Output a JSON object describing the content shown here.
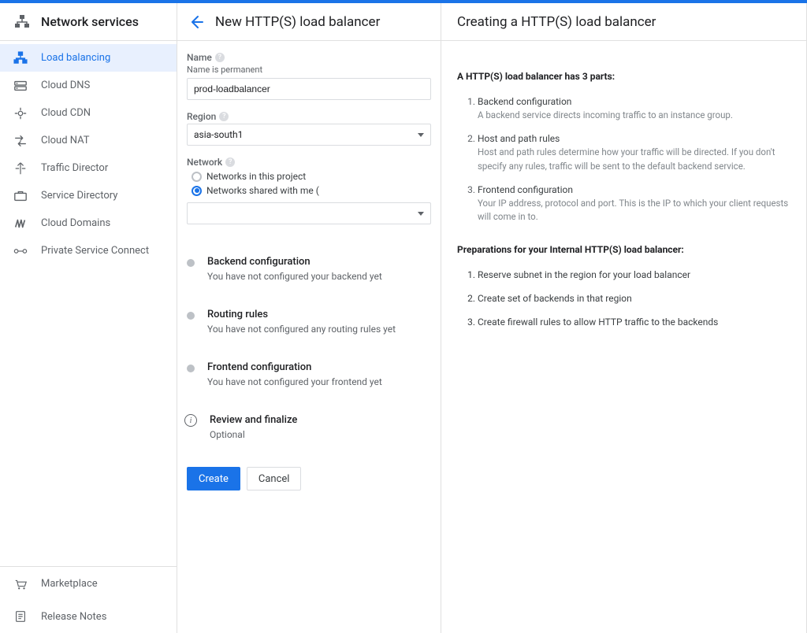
{
  "sidebar": {
    "title": "Network services",
    "items": [
      {
        "label": "Load balancing",
        "icon": "load-balancer-icon",
        "active": true
      },
      {
        "label": "Cloud DNS",
        "icon": "dns-icon"
      },
      {
        "label": "Cloud CDN",
        "icon": "cdn-icon"
      },
      {
        "label": "Cloud NAT",
        "icon": "nat-icon"
      },
      {
        "label": "Traffic Director",
        "icon": "traffic-icon"
      },
      {
        "label": "Service Directory",
        "icon": "directory-icon"
      },
      {
        "label": "Cloud Domains",
        "icon": "domains-icon"
      },
      {
        "label": "Private Service Connect",
        "icon": "psc-icon"
      }
    ],
    "footer": [
      {
        "label": "Marketplace",
        "icon": "marketplace-icon"
      },
      {
        "label": "Release Notes",
        "icon": "release-notes-icon"
      }
    ]
  },
  "main": {
    "title": "New HTTP(S) load balancer",
    "name": {
      "label": "Name",
      "sublabel": "Name is permanent",
      "value": "prod-loadbalancer"
    },
    "region": {
      "label": "Region",
      "value": "asia-south1"
    },
    "network": {
      "label": "Network",
      "option1": "Networks in this project",
      "option2": "Networks shared with me (",
      "selected": 1,
      "value": ""
    },
    "steps": [
      {
        "title": "Backend configuration",
        "sub": "You have not configured your backend yet",
        "type": "dot"
      },
      {
        "title": "Routing rules",
        "sub": "You have not configured any routing rules yet",
        "type": "dot"
      },
      {
        "title": "Frontend configuration",
        "sub": "You have not configured your frontend yet",
        "type": "dot"
      },
      {
        "title": "Review and finalize",
        "sub": "Optional",
        "type": "info"
      }
    ],
    "buttons": {
      "create": "Create",
      "cancel": "Cancel"
    }
  },
  "info": {
    "title": "Creating a HTTP(S) load balancer",
    "heading": "A HTTP(S) load balancer has 3 parts:",
    "parts": [
      {
        "t": "Backend configuration",
        "d": "A backend service directs incoming traffic to an instance group."
      },
      {
        "t": "Host and path rules",
        "d": "Host and path rules determine how your traffic will be directed. If you don't specify any rules, traffic will be sent to the default backend service."
      },
      {
        "t": "Frontend configuration",
        "d": "Your IP address, protocol and port. This is the IP to which your client requests will come in to."
      }
    ],
    "prep_heading": "Preparations for your Internal HTTP(S) load balancer:",
    "prep": [
      "Reserve subnet in the region for your load balancer",
      "Create set of backends in that region",
      "Create firewall rules to allow HTTP traffic to the backends"
    ]
  }
}
